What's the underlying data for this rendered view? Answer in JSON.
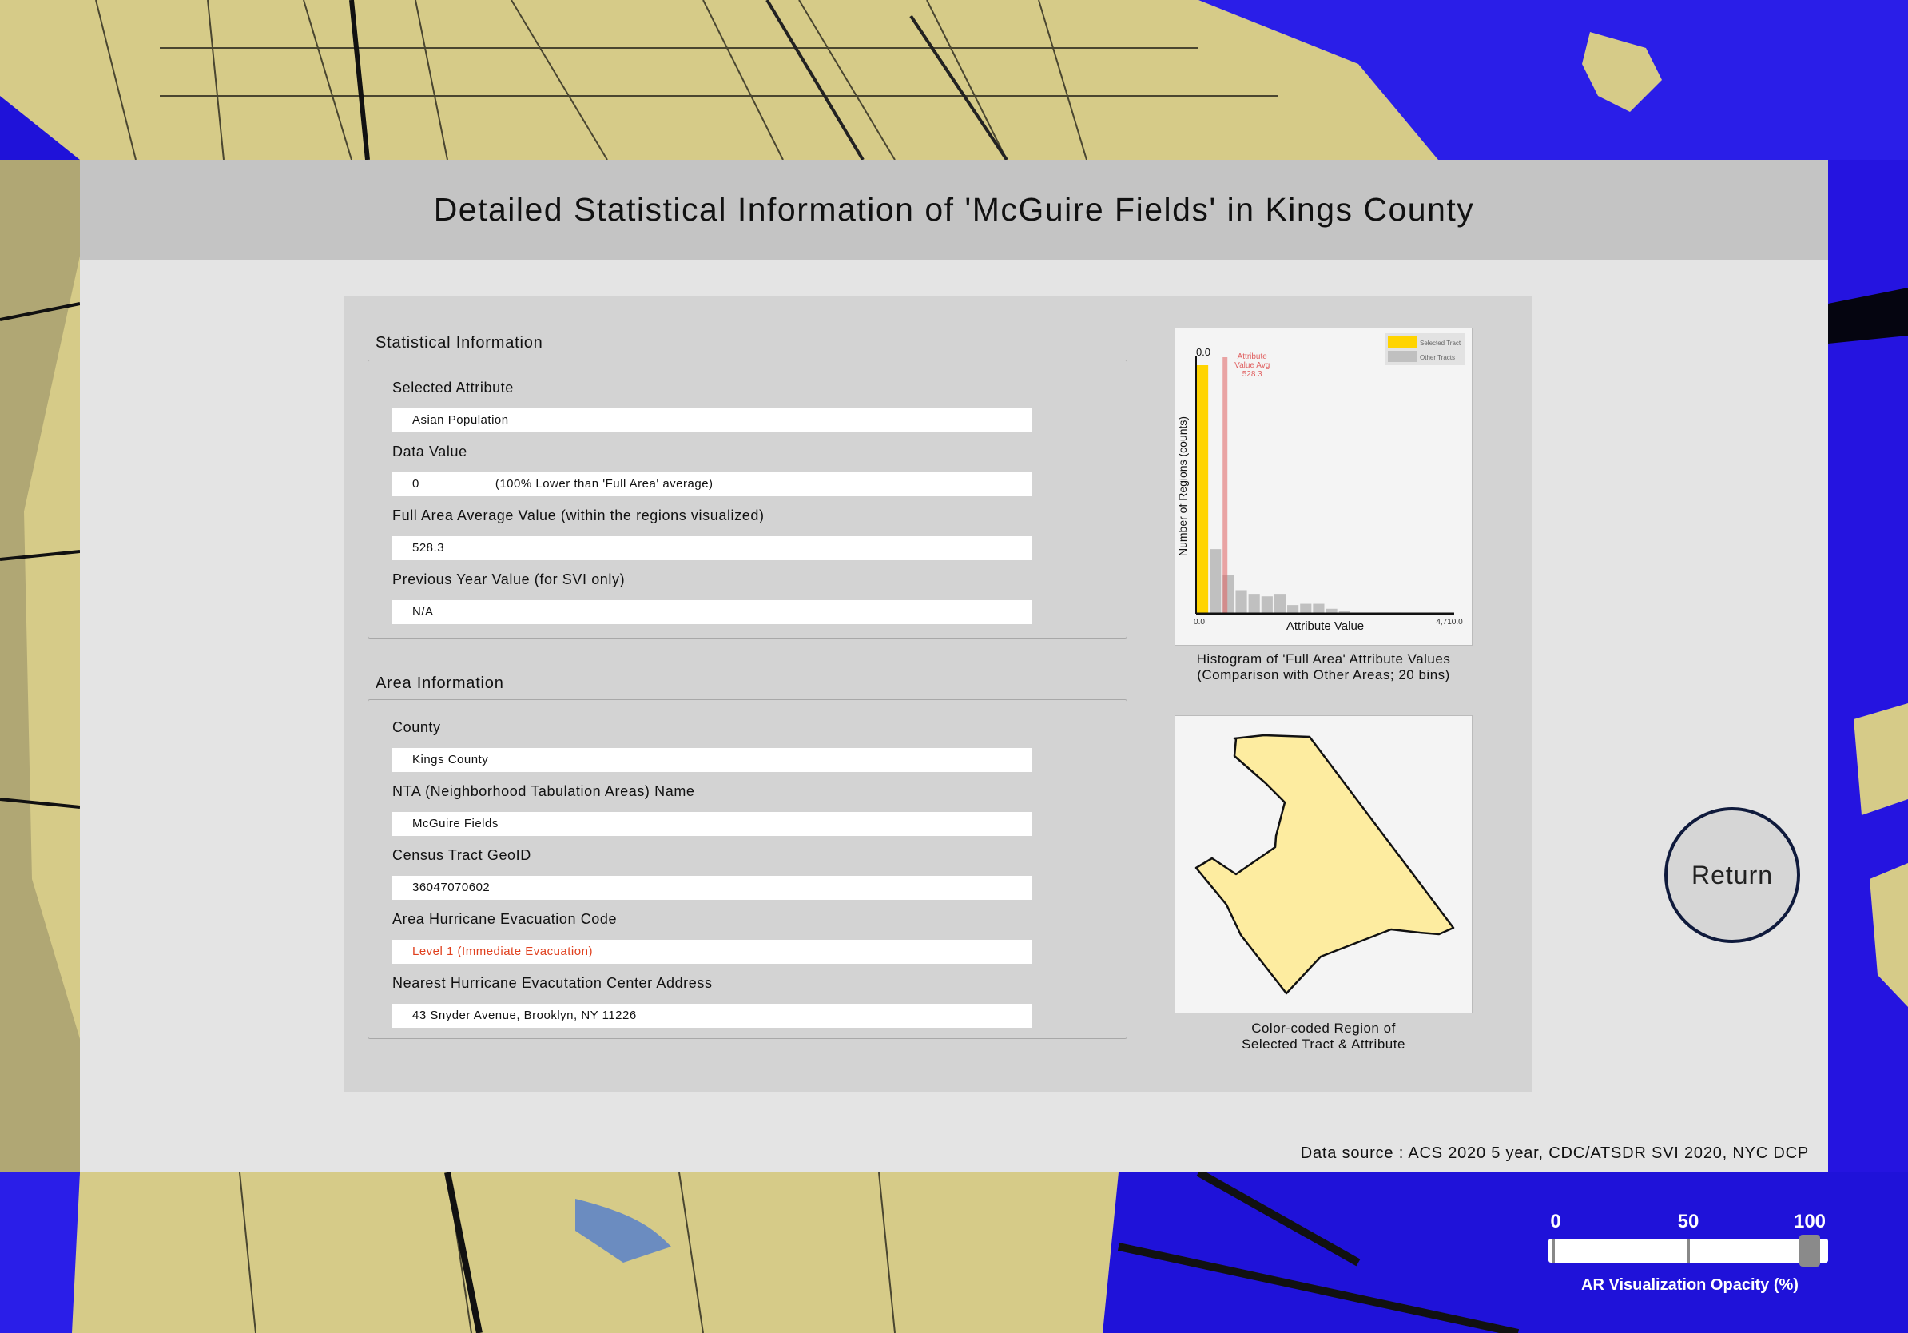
{
  "panel": {
    "title": "Detailed Statistical Information of 'McGuire Fields' in Kings County",
    "data_source": "Data source : ACS 2020 5 year, CDC/ATSDR SVI 2020, NYC DCP"
  },
  "statistical": {
    "section_title": "Statistical Information",
    "selected_attribute_label": "Selected Attribute",
    "selected_attribute_value": "Asian Population",
    "data_value_label": "Data Value",
    "data_value": "0",
    "data_value_comparison": "(100% Lower than 'Full Area' average)",
    "full_area_avg_label": "Full Area Average Value (within the regions visualized)",
    "full_area_avg_value": "528.3",
    "prev_year_label": "Previous Year Value (for SVI only)",
    "prev_year_value": "N/A"
  },
  "area": {
    "section_title": "Area Information",
    "county_label": "County",
    "county_value": "Kings County",
    "nta_label": "NTA (Neighborhood Tabulation Areas) Name",
    "nta_value": "McGuire Fields",
    "geoid_label": "Census Tract GeoID",
    "geoid_value": "36047070602",
    "evac_code_label": "Area Hurricane Evacuation Code",
    "evac_code_value": "Level 1 (Immediate Evacuation)",
    "evac_center_label": "Nearest Hurricane Evacutation Center Address",
    "evac_center_value": "43 Snyder Avenue, Brooklyn, NY 11226"
  },
  "histogram_caption_line1": "Histogram of 'Full Area' Attribute Values",
  "histogram_caption_line2": "(Comparison with Other Areas; 20 bins)",
  "map_caption_line1": "Color-coded Region of",
  "map_caption_line2": "Selected Tract & Attribute",
  "return_label": "Return",
  "opacity_slider": {
    "caption": "AR Visualization Opacity (%)",
    "ticks": [
      "0",
      "50",
      "100"
    ],
    "value": 100
  },
  "colors": {
    "selected": "#ffd400",
    "other": "#c0c0c0",
    "avg_line": "#e06060",
    "region_fill": "#fdeca0",
    "alert": "#e0401e"
  },
  "chart_data": {
    "type": "bar",
    "xlabel": "Attribute Value",
    "ylabel": "Number of Regions (counts)",
    "x_range": [
      0.0,
      4710.0
    ],
    "x_tick_labels": [
      "0.0",
      "4,710.0"
    ],
    "selected_value_label": "0.0",
    "avg_label_lines": [
      "Attribute",
      "Value Avg",
      "528.3"
    ],
    "avg_value": 528.3,
    "selected_bin": 0,
    "legend": {
      "position": "top-right",
      "entries": [
        "Selected Tract",
        "Other Tracts"
      ]
    },
    "series": [
      {
        "name": "Other Tracts",
        "values": [
          200,
          52,
          31,
          19,
          16,
          14,
          16,
          7,
          8,
          8,
          4,
          2,
          0,
          0,
          1,
          1,
          0,
          0,
          1,
          1
        ]
      }
    ]
  }
}
